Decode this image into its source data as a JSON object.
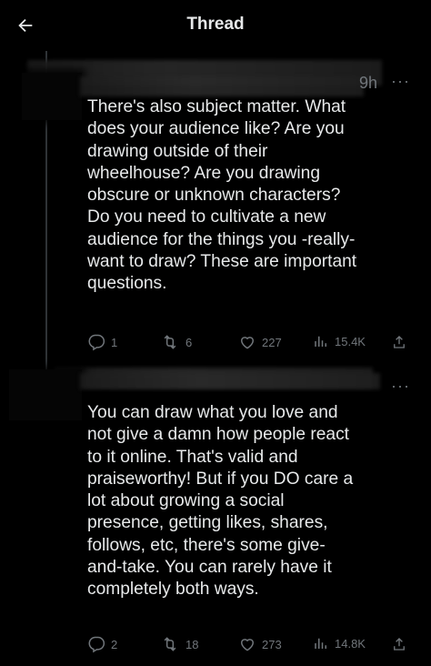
{
  "header": {
    "title": "Thread",
    "back_icon": "back-arrow-icon"
  },
  "tweets": [
    {
      "time_fragment": "9h",
      "more_label": "···",
      "lines": [
        "There's also subject matter. What",
        "does your audience like? Are you",
        "drawing outside of their",
        "wheelhouse? Are you drawing",
        "obscure or unknown characters?",
        "Do you need to cultivate a new",
        "audience for the things you -really-",
        "want to draw? These are important",
        "questions."
      ],
      "stats": {
        "replies": "1",
        "reposts": "6",
        "likes": "227",
        "views": "15.4K"
      }
    },
    {
      "time_fragment": "",
      "more_label": "···",
      "lines": [
        "You can draw what you love and",
        "not give a damn how people react",
        "to it online. That's valid and",
        "praiseworthy! But if you DO care a",
        "lot about growing a social",
        "presence, getting likes, shares,",
        "follows, etc, there's some give-",
        "and-take. You can rarely have it",
        "completely both ways."
      ],
      "stats": {
        "replies": "2",
        "reposts": "18",
        "likes": "273",
        "views": "14.8K"
      }
    }
  ],
  "colors": {
    "background": "#000000",
    "text": "#e7e9ea",
    "muted": "#71767b",
    "thread_line": "#2f3336"
  }
}
